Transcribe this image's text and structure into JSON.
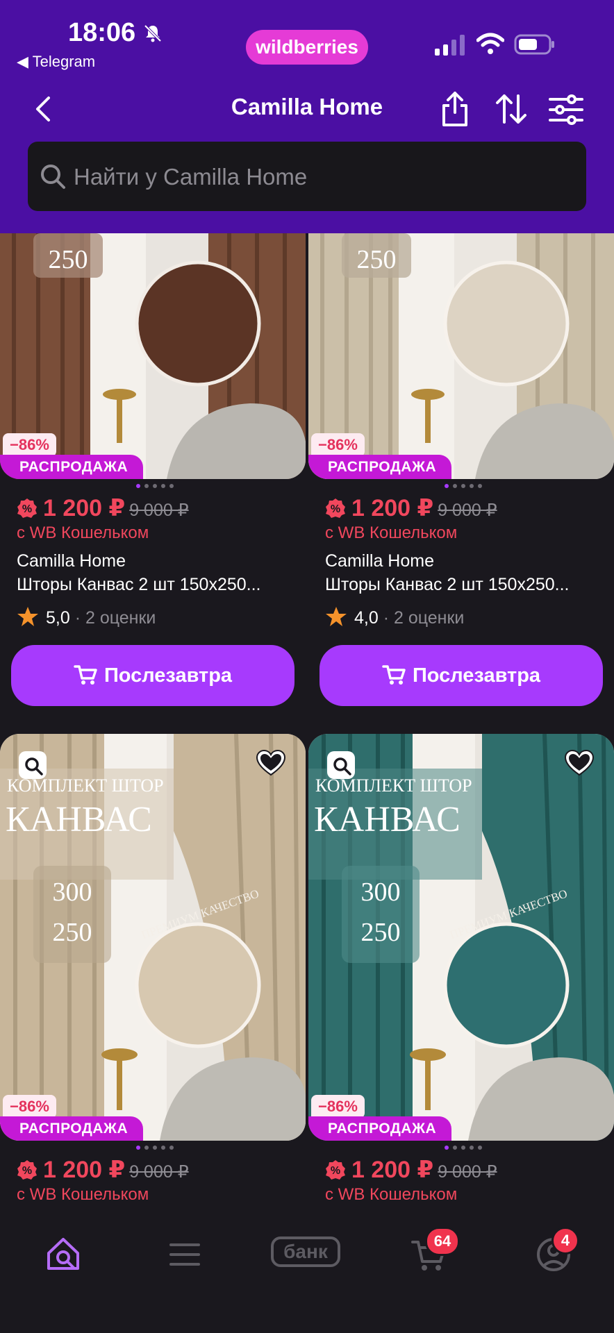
{
  "status_bar": {
    "time": "18:06",
    "back_app": "◀ Telegram",
    "brand_logo": "wildberries"
  },
  "header": {
    "title": "Camilla Home"
  },
  "search": {
    "placeholder": "Найти у Camilla Home"
  },
  "products": [
    {
      "discount": "−86%",
      "sale_label": "РАСПРОДАЖА",
      "price": "1 200 ₽",
      "old_price": "9 000 ₽",
      "wallet": "с WB Кошельком",
      "brand": "Camilla Home",
      "name": "Шторы Канвас 2 шт 150х250...",
      "rating": "5,0",
      "reviews": "· 2 оценки",
      "button": "Послезавтра",
      "image_text_top": "250",
      "colors": {
        "curtain": "#7a4e39",
        "swatch": "#5b3425"
      }
    },
    {
      "discount": "−86%",
      "sale_label": "РАСПРОДАЖА",
      "price": "1 200 ₽",
      "old_price": "9 000 ₽",
      "wallet": "с WB Кошельком",
      "brand": "Camilla Home",
      "name": "Шторы Канвас 2 шт 150х250...",
      "rating": "4,0",
      "reviews": "· 2 оценки",
      "button": "Послезавтра",
      "image_text_top": "250",
      "colors": {
        "curtain": "#cbbfa8",
        "swatch": "#ddd3c3"
      }
    },
    {
      "discount": "−86%",
      "sale_label": "РАСПРОДАЖА",
      "price": "1 200 ₽",
      "old_price": "9 000 ₽",
      "wallet": "с WB Кошельком",
      "image_title_1": "КОМПЛЕКТ ШТОР",
      "image_title_2": "КАНВАС",
      "size_w": "300",
      "size_h": "250",
      "quality": "ПРЕМИУМ КАЧЕСТВО",
      "colors": {
        "curtain": "#c8b69a",
        "swatch": "#d7c8b0"
      }
    },
    {
      "discount": "−86%",
      "sale_label": "РАСПРОДАЖА",
      "price": "1 200 ₽",
      "old_price": "9 000 ₽",
      "wallet": "с WB Кошельком",
      "image_title_1": "КОМПЛЕКТ ШТОР",
      "image_title_2": "КАНВАС",
      "size_w": "300",
      "size_h": "250",
      "quality": "ПРЕМИУМ КАЧЕСТВО",
      "colors": {
        "curtain": "#2f6e6c",
        "swatch": "#2e6f70"
      }
    }
  ],
  "tabbar": {
    "bank_label": "банк",
    "cart_count": "64",
    "profile_count": "4"
  },
  "theme": {
    "header": "#4b0fa3",
    "accent": "#a73afd",
    "price": "#f1475d",
    "background": "#1a181e"
  }
}
